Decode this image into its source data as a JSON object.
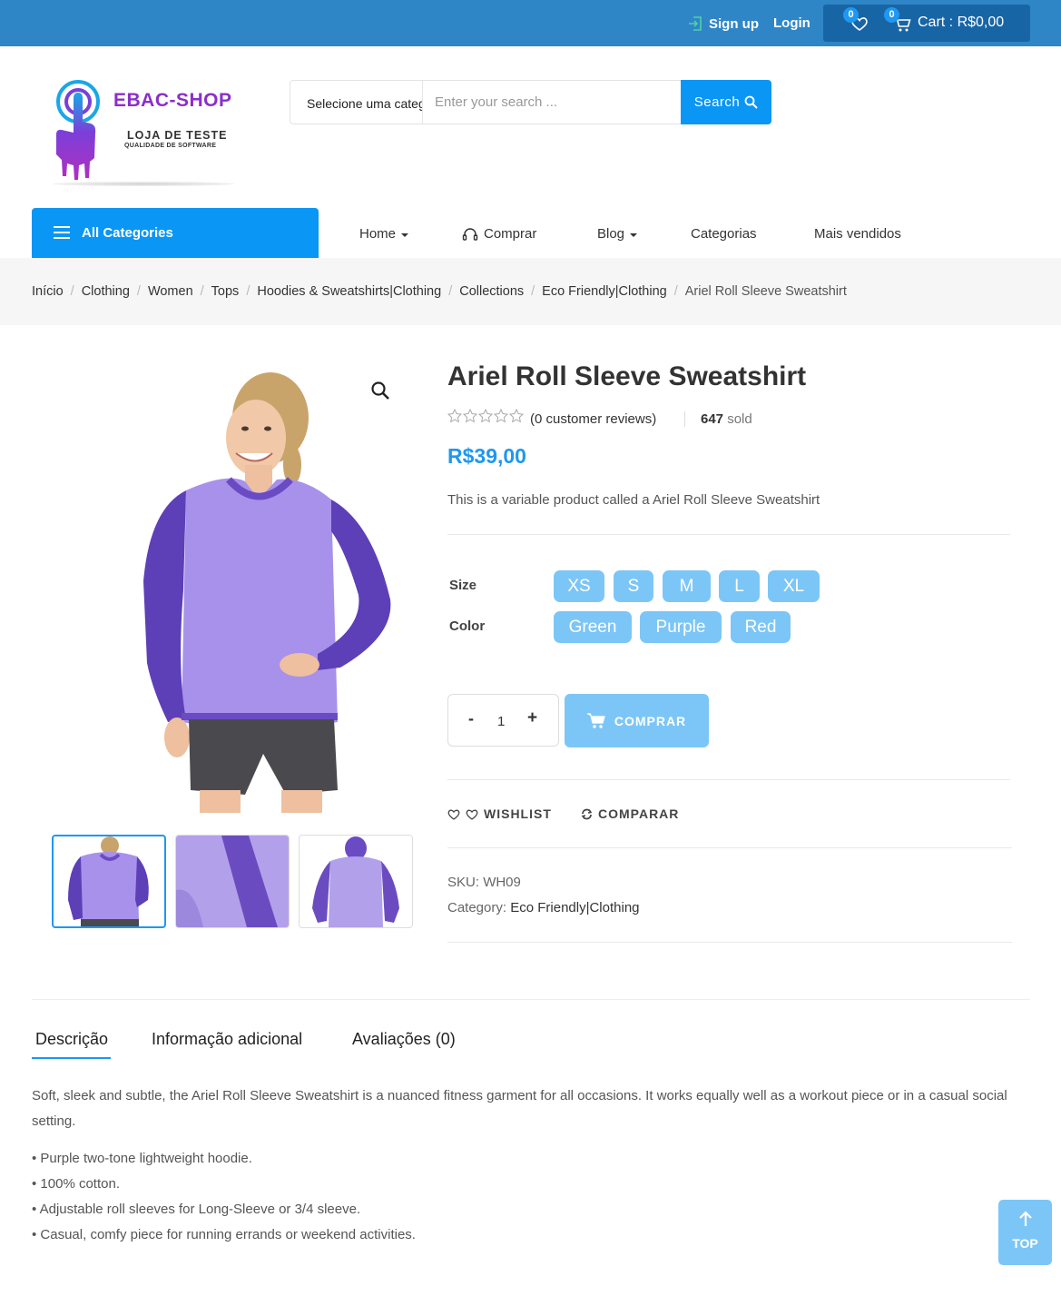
{
  "header": {
    "signup_label": "Sign up",
    "login_label": "Login",
    "wishlist_count": "0",
    "cart_count": "0",
    "cart_label": "Cart : R$0,00"
  },
  "logo": {
    "brand": "EBAC-SHOP",
    "tagline": "LOJA DE TESTE",
    "subtagline": "QUALIDADE DE SOFTWARE"
  },
  "search": {
    "category_label": "Selecione uma categoria",
    "placeholder": "Enter your search ...",
    "button_label": "Search"
  },
  "nav": {
    "all_categories": "All Categories",
    "items": [
      "Home",
      "Comprar",
      "Blog",
      "Categorias",
      "Mais vendidos"
    ]
  },
  "breadcrumb": [
    "Início",
    "Clothing",
    "Women",
    "Tops",
    "Hoodies & Sweatshirts|Clothing",
    "Collections",
    "Eco Friendly|Clothing",
    "Ariel Roll Sleeve Sweatshirt"
  ],
  "product": {
    "title": "Ariel Roll Sleeve Sweatshirt",
    "rating": 0,
    "reviews": "(0 customer reviews)",
    "sold_count": "647",
    "sold_label": "sold",
    "price": "R$39,00",
    "short_description": "This is a variable product called a Ariel Roll Sleeve Sweatshirt",
    "size_label": "Size",
    "sizes": [
      "XS",
      "S",
      "M",
      "L",
      "XL"
    ],
    "color_label": "Color",
    "colors": [
      "Green",
      "Purple",
      "Red"
    ],
    "qty_minus": "-",
    "quantity": "1",
    "qty_plus": "+",
    "buy_label": "COMPRAR",
    "wishlist_label": "WISHLIST",
    "compare_label": "COMPARAR",
    "sku_label": "SKU:",
    "sku": "WH09",
    "category_label": "Category:",
    "category": "Eco Friendly|Clothing"
  },
  "tabs": [
    "Descrição",
    "Informação adicional",
    "Avaliações (0)"
  ],
  "description": {
    "text": "Soft, sleek and subtle, the Ariel Roll Sleeve Sweatshirt is a nuanced fitness garment for all occasions. It works equally well as a workout piece or in a casual social setting.",
    "bullets": [
      "• Purple two-tone lightweight hoodie.",
      "• 100% cotton.",
      "• Adjustable roll sleeves for Long-Sleeve or 3/4 sleeve.",
      "• Casual, comfy piece for running errands or weekend activities."
    ]
  },
  "scroll_top_label": "TOP",
  "colors": {
    "topbar": "#2f86c6",
    "accent": "#0a96f5",
    "swatch": "#7cc6f7",
    "brand": "#8b2fc9"
  }
}
